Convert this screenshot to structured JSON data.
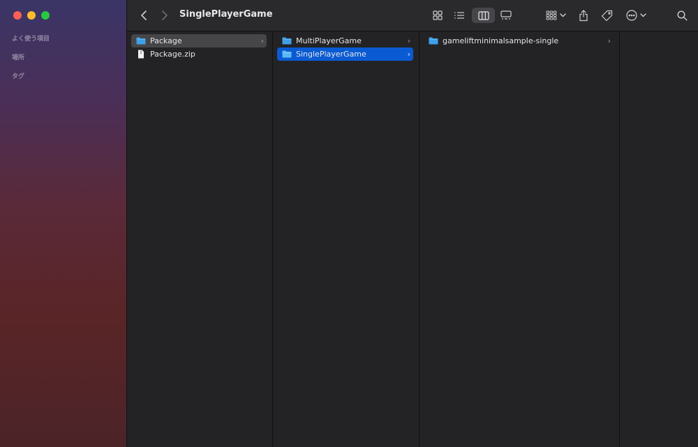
{
  "window": {
    "title": "SinglePlayerGame"
  },
  "sidebar": {
    "sections": [
      {
        "label": "よく使う項目"
      },
      {
        "label": "場所"
      },
      {
        "label": "タグ"
      }
    ]
  },
  "toolbar": {
    "back_icon": "chevron-left-icon",
    "forward_icon": "chevron-right-icon",
    "views": [
      "icon-view-icon",
      "list-view-icon",
      "column-view-icon",
      "gallery-view-icon"
    ],
    "active_view": "column-view-icon"
  },
  "columns": [
    {
      "items": [
        {
          "name": "Package",
          "type": "folder",
          "state": "selected-inactive",
          "has_children": true
        },
        {
          "name": "Package.zip",
          "type": "file",
          "state": "none",
          "has_children": false
        }
      ]
    },
    {
      "items": [
        {
          "name": "MultiPlayerGame",
          "type": "folder",
          "state": "none",
          "has_children": true
        },
        {
          "name": "SinglePlayerGame",
          "type": "folder",
          "state": "selected",
          "has_children": true
        }
      ]
    },
    {
      "items": [
        {
          "name": "gameliftminimalsample-single",
          "type": "folder",
          "state": "none",
          "has_children": true
        }
      ]
    },
    {
      "items": []
    }
  ],
  "colors": {
    "accent": "#0a5bd3",
    "folder": "#3ea0e8"
  }
}
